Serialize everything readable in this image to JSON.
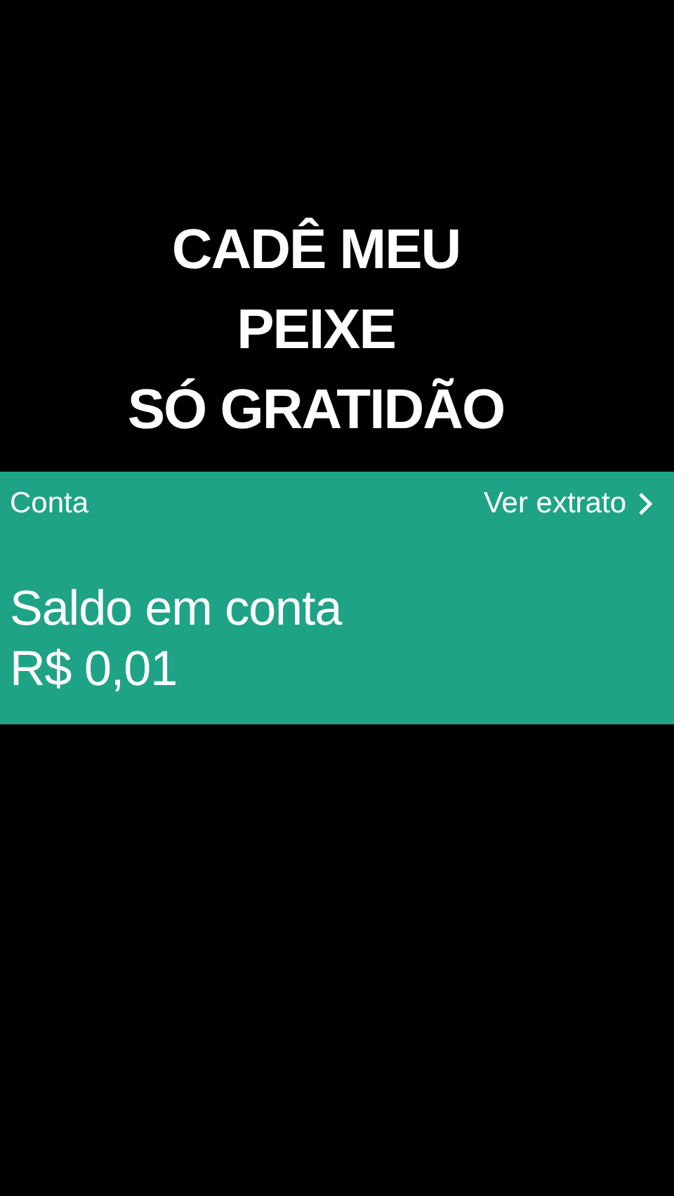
{
  "caption": {
    "lines": [
      "CADÊ MEU",
      "PEIXE",
      "SÓ GRATIDÃO"
    ]
  },
  "account_card": {
    "title": "Conta",
    "link": "Ver extrato",
    "balance_label": "Saldo em conta",
    "balance": "R$ 0,01"
  }
}
